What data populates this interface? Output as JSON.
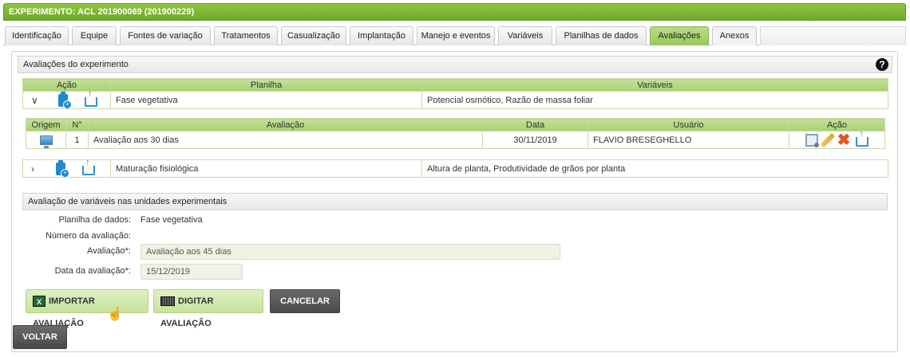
{
  "window_title": "EXPERIMENTO: ACL 201900069 (201900229)",
  "tabs": [
    {
      "label": "Identificação"
    },
    {
      "label": "Equipe"
    },
    {
      "label": "Fontes de variação"
    },
    {
      "label": "Tratamentos"
    },
    {
      "label": "Casualização"
    },
    {
      "label": "Implantação"
    },
    {
      "label": "Manejo e eventos"
    },
    {
      "label": "Variáveis"
    },
    {
      "label": "Planilhas de dados"
    },
    {
      "label": "Avaliações",
      "active": true
    },
    {
      "label": "Anexos"
    }
  ],
  "avaliacoes": {
    "title": "Avaliações do experimento",
    "help_icon": "question-circle-icon",
    "headers": {
      "acao": "Ação",
      "planilha": "Planilha",
      "variaveis": "Variáveis"
    },
    "rows": [
      {
        "expanded": true,
        "planilha": "Fase vegetativa",
        "variaveis": "Potencial osmótico, Razão de massa foliar"
      },
      {
        "expanded": false,
        "planilha": "Maturação fisiológica",
        "variaveis": "Altura de planta, Produtividade de grãos por planta"
      }
    ],
    "inner": {
      "headers": {
        "origem": "Origem",
        "numero": "N°",
        "avaliacao": "Avaliação",
        "data": "Data",
        "usuario": "Usuário",
        "acao": "Ação"
      },
      "rows": [
        {
          "numero": "1",
          "avaliacao": "Avaliação aos 30 dias",
          "data": "30/11/2019",
          "usuario": "FLAVIO BRESEGHELLO"
        }
      ]
    }
  },
  "form": {
    "title": "Avaliação de variáveis nas unidades experimentais",
    "planilha_label": "Planilha de dados:",
    "planilha_value": "Fase vegetativa",
    "numero_label": "Número da avaliação:",
    "avaliacao_label": "Avaliação*:",
    "avaliacao_value": "Avaliação aos 45 dias",
    "data_label": "Data da avaliação*:",
    "data_value": "15/12/2019"
  },
  "buttons": {
    "importar": "IMPORTAR AVALIAÇÃO",
    "digitar": "DIGITAR AVALIAÇÃO",
    "cancelar": "CANCELAR",
    "voltar": "VOLTAR"
  },
  "colors": {
    "accent_green": "#8dc63f",
    "header_green": "#b6dc86",
    "button_dark": "#555555"
  }
}
